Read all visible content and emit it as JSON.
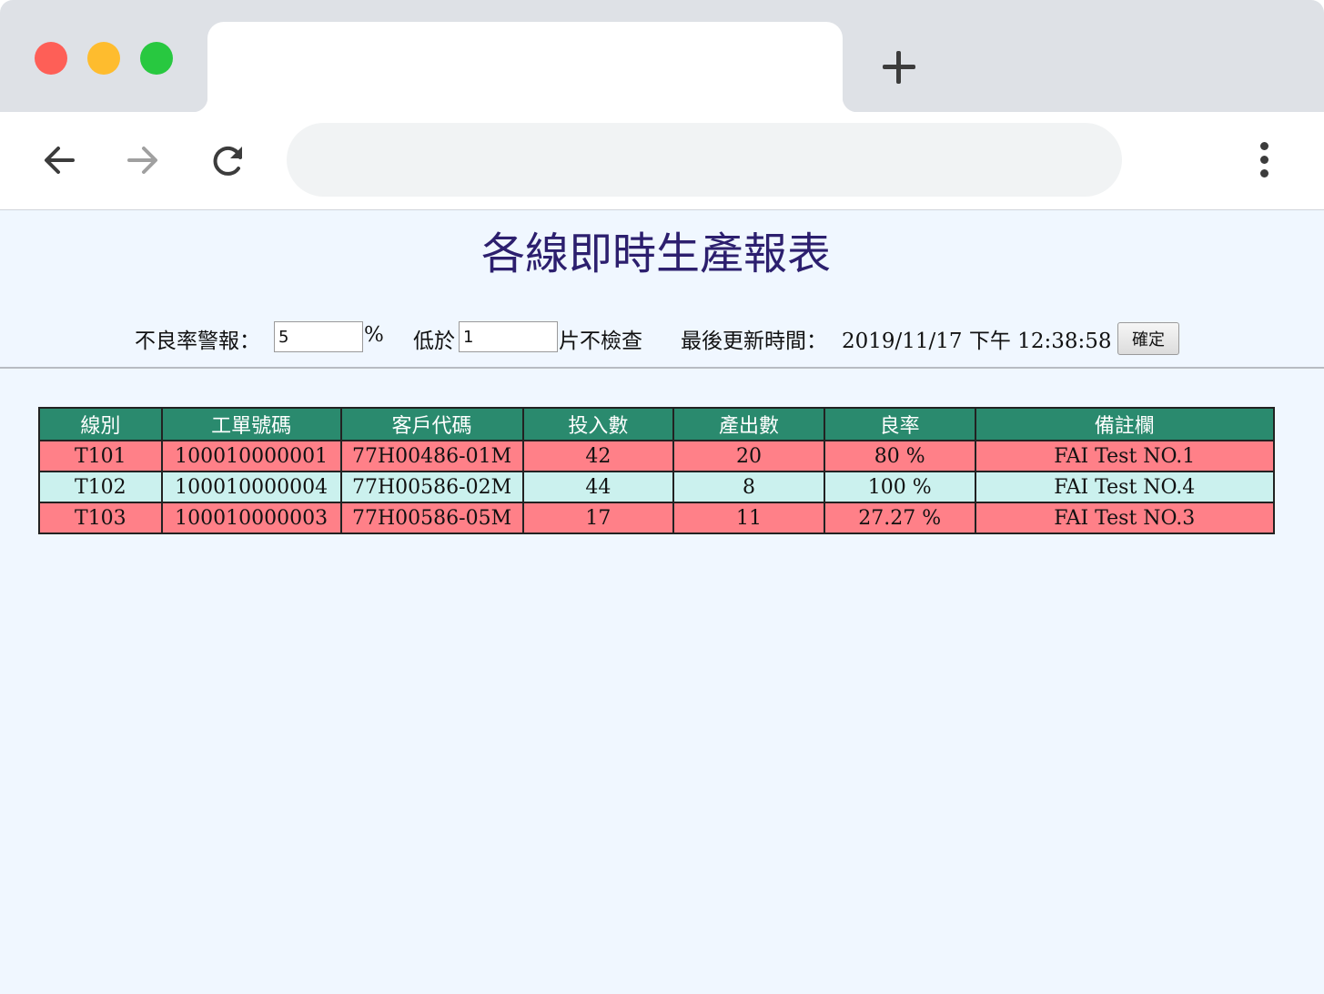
{
  "page": {
    "title": "各線即時生產報表"
  },
  "controls": {
    "defect_alert_label": "不良率警報：",
    "defect_alert_value": "5",
    "percent_sign": "%",
    "below_label": "低於",
    "below_value": "1",
    "skip_label": "片不檢查",
    "last_update_label": "最後更新時間：",
    "last_update_value": "2019/11/17 下午 12:38:58",
    "confirm_label": "確定"
  },
  "table": {
    "headers": [
      "線別",
      "工單號碼",
      "客戶代碼",
      "投入數",
      "產出數",
      "良率",
      "備註欄"
    ],
    "rows": [
      {
        "status": "warn",
        "cells": [
          "T101",
          "100010000001",
          "77H00486-01M",
          "42",
          "20",
          "80 %",
          "FAI Test NO.1"
        ]
      },
      {
        "status": "ok",
        "cells": [
          "T102",
          "100010000004",
          "77H00586-02M",
          "44",
          "8",
          "100 %",
          "FAI Test NO.4"
        ]
      },
      {
        "status": "warn",
        "cells": [
          "T103",
          "100010000003",
          "77H00586-05M",
          "17",
          "11",
          "27.27 %",
          "FAI Test NO.3"
        ]
      }
    ]
  },
  "colors": {
    "header_bg": "#2a8a6e",
    "row_warn": "#ff8088",
    "row_ok": "#cbf1ee",
    "title": "#2c1f6e"
  },
  "icons": {
    "back": "arrow-left-icon",
    "forward": "arrow-right-icon",
    "reload": "reload-icon",
    "menu": "kebab-menu-icon",
    "new_tab": "plus-icon"
  }
}
